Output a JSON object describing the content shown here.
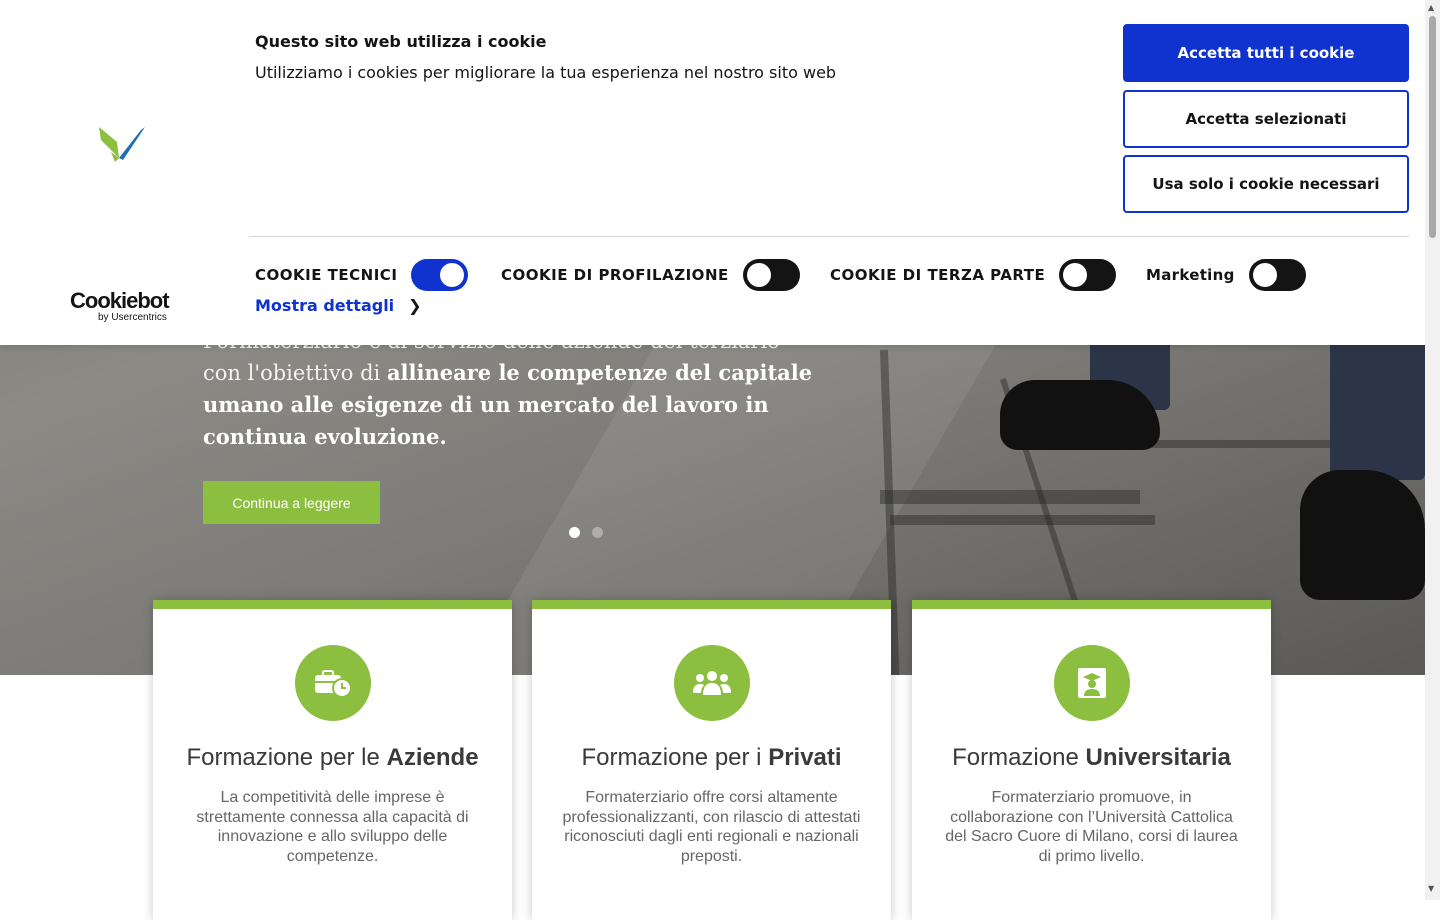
{
  "cookie_banner": {
    "title": "Questo sito web utilizza i cookie",
    "text": "Utilizziamo i cookies per migliorare la tua esperienza nel nostro sito web",
    "buttons": {
      "accept_all": "Accetta tutti i cookie",
      "accept_selected": "Accetta selezionati",
      "necessary_only": "Usa solo i cookie necessari"
    },
    "toggles": [
      {
        "label": "COOKIE TECNICI",
        "on": true
      },
      {
        "label": "COOKIE DI PROFILAZIONE",
        "on": false
      },
      {
        "label": "COOKIE DI TERZA PARTE",
        "on": false
      },
      {
        "label": "Marketing",
        "on": false
      }
    ],
    "details_link": "Mostra dettagli",
    "cookiebot": {
      "name": "Cookiebot",
      "by": "by Usercentrics"
    },
    "accent_color": "#1032cf"
  },
  "hero": {
    "text_start": "Formaterziario è al servizio delle aziende del terziario con l'obiettivo di ",
    "text_bold": "allineare le competenze del capitale umano alle esigenze di un mercato del lavoro in continua evoluzione.",
    "button": "Continua a leggere",
    "slides_count": 2,
    "active_slide": 1
  },
  "cards": [
    {
      "icon": "briefcase-clock-icon",
      "title_prefix": "Formazione per le ",
      "title_bold": "Aziende",
      "text": "La competitività delle imprese è strettamente connessa alla capacità di innovazione e allo sviluppo delle competenze."
    },
    {
      "icon": "users-group-icon",
      "title_prefix": "Formazione per i ",
      "title_bold": "Privati",
      "text": "Formaterziario offre corsi altamente professionalizzanti, con rilascio di attestati riconosciuti dagli enti regionali e nazionali preposti."
    },
    {
      "icon": "graduate-icon",
      "title_prefix": "Formazione ",
      "title_bold": "Universitaria",
      "text": "Formaterziario promuove, in collaborazione con l’Università Cattolica del Sacro Cuore di Milano, corsi di laurea di primo livello."
    }
  ],
  "colors": {
    "brand_green": "#8cbf3f",
    "brand_blue": "#1e6fb8"
  }
}
